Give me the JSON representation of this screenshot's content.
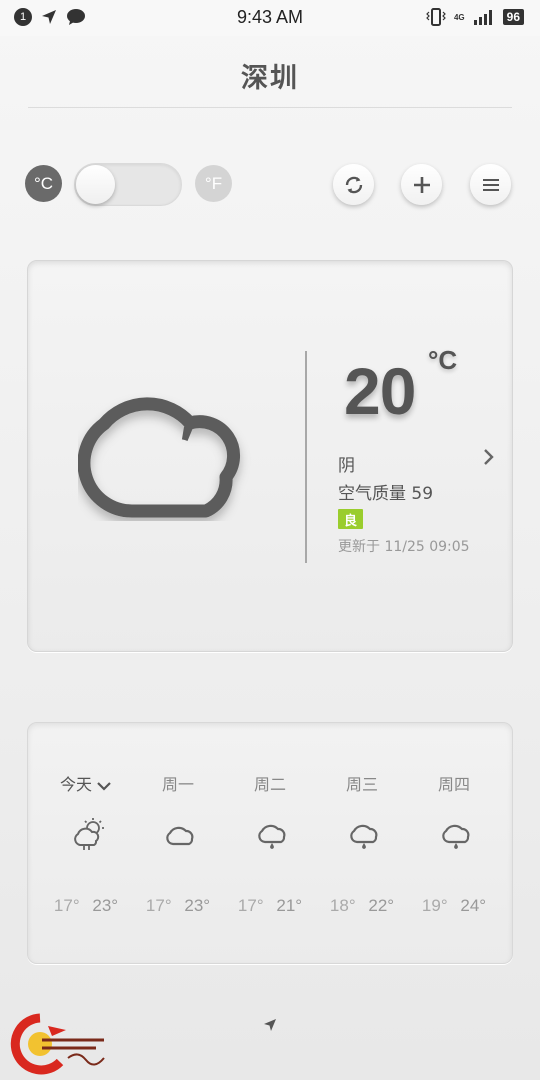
{
  "status_bar": {
    "notification_count": "1",
    "time": "9:43 AM",
    "network_type": "4G",
    "battery_level": "96"
  },
  "header": {
    "city": "深圳"
  },
  "units": {
    "celsius": "°C",
    "fahrenheit": "°F",
    "selected": "celsius"
  },
  "toolbar": {
    "icons": [
      "refresh-icon",
      "plus-icon",
      "menu-icon"
    ]
  },
  "current": {
    "temperature": "20",
    "unit": "°C",
    "condition": "阴",
    "aqi_text": "空气质量 59",
    "aqi_level": "良",
    "updated": "更新于 11/25 09:05",
    "icon": "cloud-icon"
  },
  "forecast": [
    {
      "day": "今天",
      "low": "17°",
      "high": "23°",
      "icon": "partly-sunny-rain-icon"
    },
    {
      "day": "周一",
      "low": "17°",
      "high": "23°",
      "icon": "cloud-icon"
    },
    {
      "day": "周二",
      "low": "17°",
      "high": "21°",
      "icon": "cloud-rain-icon"
    },
    {
      "day": "周三",
      "low": "18°",
      "high": "22°",
      "icon": "cloud-rain-icon"
    },
    {
      "day": "周四",
      "low": "19°",
      "high": "24°",
      "icon": "cloud-rain-icon"
    }
  ],
  "colors": {
    "aqi_good": "#9acd2d",
    "text_dark": "#555555",
    "unit_active": "#6a6a6a",
    "unit_inactive": "#d4d4d4"
  }
}
